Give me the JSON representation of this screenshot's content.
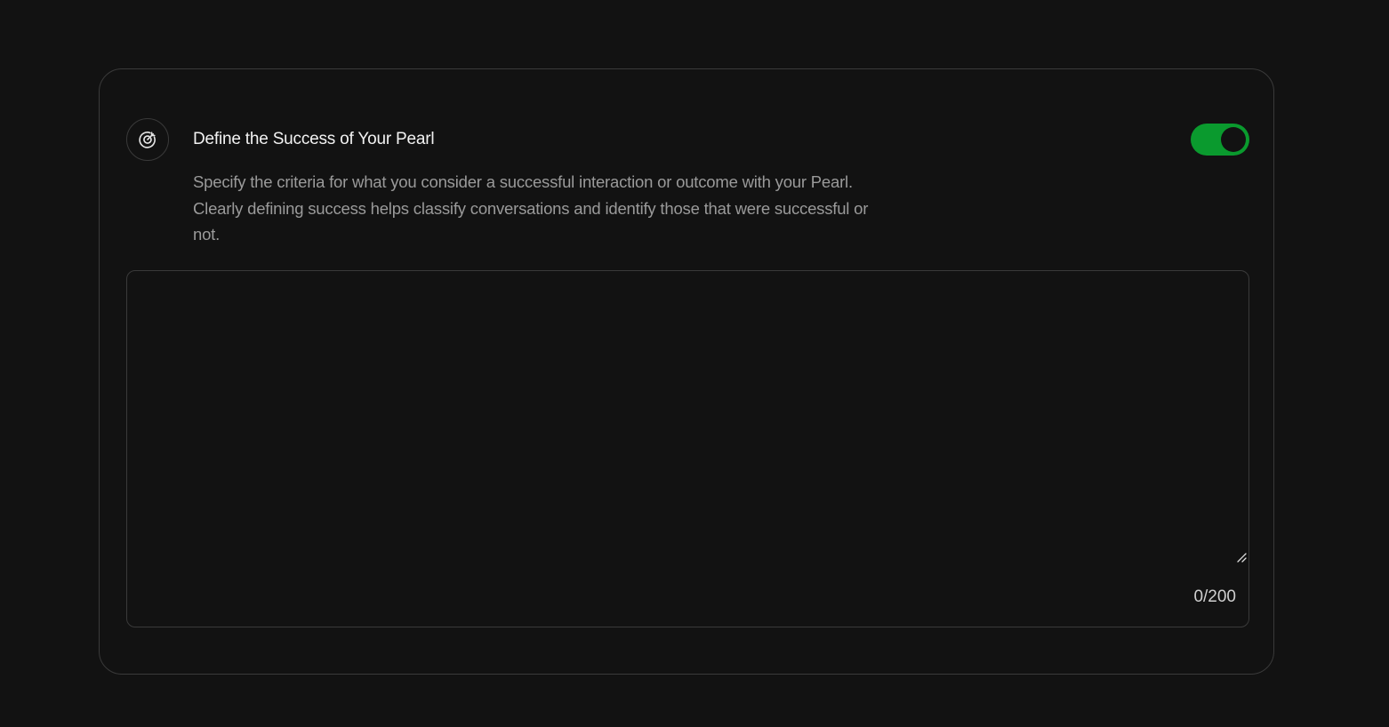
{
  "section": {
    "icon": "target-icon",
    "title": "Define the Success of Your Pearl",
    "description": "Specify the criteria for what you consider a successful interaction or outcome with your Pearl. Clearly defining success helps classify conversations and identify those that were successful or not.",
    "toggle_on": true
  },
  "input": {
    "value": "",
    "counter": "0/200"
  },
  "colors": {
    "background": "#121212",
    "border": "#3a3a3a",
    "toggle_on": "#0a9a2e",
    "title_text": "#f2f2f2",
    "description_text": "#9a9a9a"
  }
}
